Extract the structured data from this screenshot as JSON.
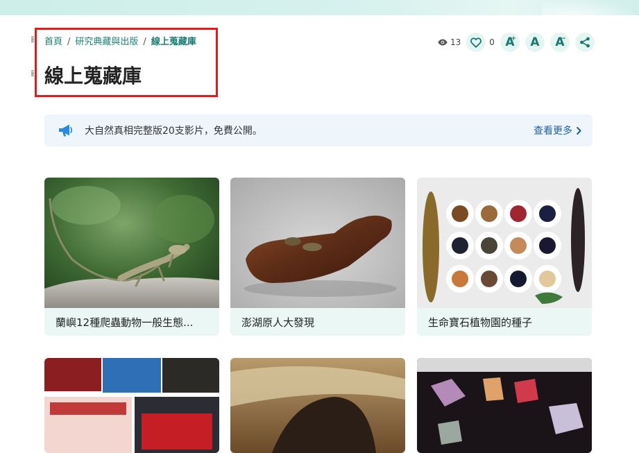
{
  "breadcrumb": {
    "home": "首頁",
    "level1": "研究典藏與出版",
    "current": "線上蒐藏庫",
    "separator": "/"
  },
  "page": {
    "title": "線上蒐藏庫"
  },
  "toolbar": {
    "views": "13",
    "likes": "0",
    "font_increase": "A",
    "font_increase_sup": "+",
    "font_normal": "A",
    "font_decrease": "A",
    "font_decrease_sup": "−"
  },
  "notice": {
    "text": "大自然真相完整版20支影片，免費公開。",
    "more_label": "查看更多"
  },
  "cards": [
    {
      "title": "蘭嶼12種爬蟲動物一般生態..."
    },
    {
      "title": "澎湖原人大發現"
    },
    {
      "title": "生命寶石植物園的種子"
    }
  ],
  "icons": {
    "views": "eye-icon",
    "like": "heart-icon",
    "share": "share-icon",
    "notice": "megaphone-icon",
    "more": "chevron-right-icon"
  },
  "colors": {
    "accent": "#177a70",
    "link": "#1d5fa7",
    "highlight": "#e01b1b",
    "notice_bg": "#eef6fb",
    "card_bg": "#eaf7f5"
  }
}
